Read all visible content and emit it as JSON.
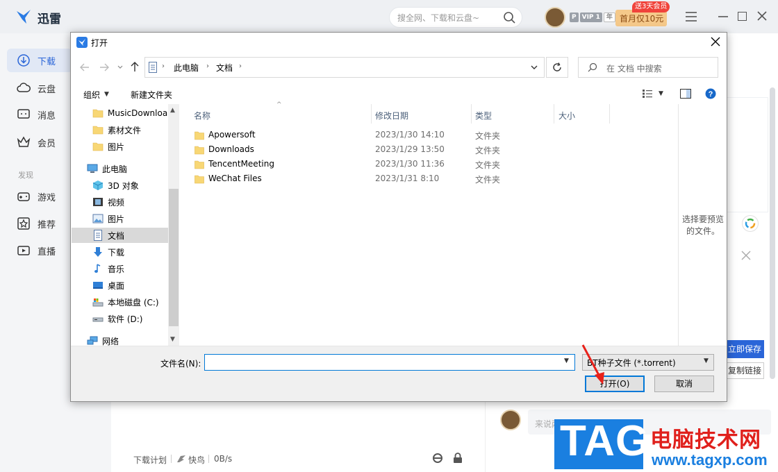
{
  "app": {
    "title": "迅雷",
    "search_placeholder": "搜全网、下载和云盘~",
    "vip_badges": [
      "P",
      "VIP 1",
      "年"
    ],
    "promo_text": "首月仅10元",
    "promo_tag": "送3天会员",
    "sidebar": {
      "items": [
        {
          "label": "下载",
          "icon": "download-icon",
          "active": true
        },
        {
          "label": "云盘",
          "icon": "cloud-icon"
        },
        {
          "label": "消息",
          "icon": "message-icon"
        },
        {
          "label": "会员",
          "icon": "crown-icon"
        }
      ],
      "section_label": "发现",
      "discover_items": [
        {
          "label": "游戏",
          "icon": "gamepad-icon"
        },
        {
          "label": "推荐",
          "icon": "star-icon"
        },
        {
          "label": "直播",
          "icon": "live-icon"
        }
      ]
    },
    "right_panel": {
      "save_button": "立即保存",
      "copy_link_button": "复制链接",
      "comment_placeholder": "来说两句"
    },
    "status_bar": {
      "plan": "下载计划",
      "fast": "快鸟",
      "speed": "0B/s"
    }
  },
  "dialog": {
    "title": "打开",
    "breadcrumb": [
      "此电脑",
      "文档"
    ],
    "search_placeholder": "在 文档 中搜索",
    "toolbar": {
      "organize": "组织",
      "new_folder": "新建文件夹"
    },
    "tree": [
      {
        "label": "MusicDownloa",
        "icon": "folder-icon",
        "indent": 1
      },
      {
        "label": "素材文件",
        "icon": "folder-icon",
        "indent": 1
      },
      {
        "label": "图片",
        "icon": "folder-icon",
        "indent": 1
      },
      {
        "label": "此电脑",
        "icon": "computer-icon",
        "indent": 0
      },
      {
        "label": "3D 对象",
        "icon": "cube-icon",
        "indent": 1
      },
      {
        "label": "视频",
        "icon": "video-icon",
        "indent": 1
      },
      {
        "label": "图片",
        "icon": "picture-icon",
        "indent": 1
      },
      {
        "label": "文档",
        "icon": "document-icon",
        "indent": 1,
        "selected": true
      },
      {
        "label": "下载",
        "icon": "download-arrow-icon",
        "indent": 1
      },
      {
        "label": "音乐",
        "icon": "music-icon",
        "indent": 1
      },
      {
        "label": "桌面",
        "icon": "desktop-icon",
        "indent": 1
      },
      {
        "label": "本地磁盘 (C:)",
        "icon": "drive-c-icon",
        "indent": 1
      },
      {
        "label": "软件 (D:)",
        "icon": "drive-d-icon",
        "indent": 1
      },
      {
        "label": "网络",
        "icon": "network-icon",
        "indent": 0
      }
    ],
    "columns": {
      "name": "名称",
      "date": "修改日期",
      "type": "类型",
      "size": "大小"
    },
    "files": [
      {
        "name": "Apowersoft",
        "date": "2023/1/30 14:10",
        "type": "文件夹"
      },
      {
        "name": "Downloads",
        "date": "2023/1/29 13:50",
        "type": "文件夹"
      },
      {
        "name": "TencentMeeting",
        "date": "2023/1/30 11:36",
        "type": "文件夹"
      },
      {
        "name": "WeChat Files",
        "date": "2023/1/31 8:10",
        "type": "文件夹"
      }
    ],
    "preview_text": "选择要预览的文件。",
    "filename_label": "文件名(N):",
    "filename_value": "",
    "filetype_value": "BT种子文件 (*.torrent)",
    "open_button": "打开(O)",
    "cancel_button": "取消"
  },
  "watermark": {
    "tag": "TAG",
    "cn": "电脑技术网",
    "url": "www.tagxp.com"
  }
}
